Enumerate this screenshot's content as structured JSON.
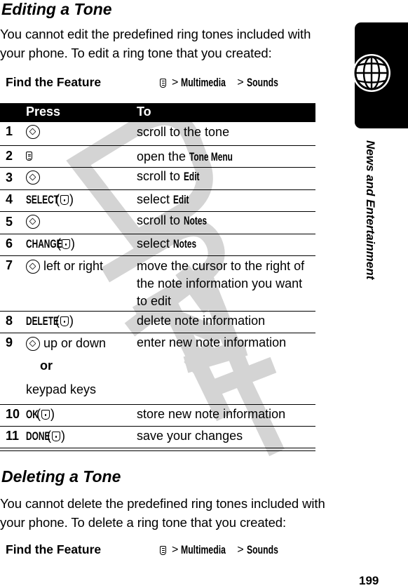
{
  "section1": {
    "title": "Editing a Tone",
    "paragraph_lines": [
      "You cannot edit the predefined ring tones included with",
      "your phone. To edit a ring tone that you created:"
    ],
    "find_the_feature": {
      "label": "Find the Feature",
      "menu_icon": "menu-key-icon",
      "path": [
        "Multimedia",
        "Sounds"
      ],
      "separator": ">"
    }
  },
  "table": {
    "headers": [
      "Press",
      "To"
    ],
    "rows": [
      {
        "num": "1",
        "press_icon": "nav-key-icon",
        "press_text": "",
        "to_plain": "scroll to the tone",
        "to_bold": ""
      },
      {
        "num": "2",
        "press_icon": "menu-key-icon",
        "press_text": "",
        "to_plain": "open the ",
        "to_bold": "Tone Menu"
      },
      {
        "num": "3",
        "press_icon": "nav-key-icon",
        "press_text": "",
        "to_plain": "scroll to ",
        "to_bold": "Edit"
      },
      {
        "num": "4",
        "press_softkey": "SELECT",
        "press_icon": "select-key-icon",
        "to_plain": "select ",
        "to_bold": "Edit"
      },
      {
        "num": "5",
        "press_icon": "nav-key-icon",
        "press_text": "",
        "to_plain": "scroll to ",
        "to_bold": "Notes"
      },
      {
        "num": "6",
        "press_softkey": "CHANGE",
        "press_icon": "select-key-icon",
        "to_plain": "select ",
        "to_bold": "Notes"
      },
      {
        "num": "7",
        "press_icon": "nav-key-icon",
        "press_text": "left or right",
        "to_lines": [
          "move the cursor to the right of",
          "the note information you want",
          "to edit"
        ]
      },
      {
        "num": "8",
        "press_softkey": "DELETE",
        "press_icon": "select-key-icon",
        "to_plain": "delete note information",
        "to_bold": ""
      },
      {
        "num": "9",
        "press_icon": "nav-key-icon",
        "press_text": "up or down",
        "press_or": "or",
        "press_alt": "keypad keys",
        "to_plain": "enter new note information",
        "to_bold": ""
      },
      {
        "num": "10",
        "press_softkey": "OK",
        "press_icon": "select-key-icon",
        "to_plain": "store new note information",
        "to_bold": ""
      },
      {
        "num": "11",
        "press_softkey": "DONE",
        "press_icon": "select-key-icon",
        "to_plain": "save your changes",
        "to_bold": ""
      }
    ]
  },
  "section2": {
    "title": "Deleting a Tone",
    "paragraph_lines": [
      "You cannot delete the predefined ring tones included with",
      "your phone. To delete a ring tone that you created:"
    ],
    "find_the_feature": {
      "label": "Find the Feature",
      "menu_icon": "menu-key-icon",
      "path": [
        "Multimedia",
        "Sounds"
      ],
      "separator": ">"
    }
  },
  "side_tab": {
    "icon": "globe-icon",
    "label": "News and Entertainment"
  },
  "watermark": "DRAFT",
  "page_number": "199",
  "colors": {
    "text": "#000000",
    "watermark": "#c8c8c8",
    "header_bg": "#000000",
    "header_text": "#ffffff"
  }
}
